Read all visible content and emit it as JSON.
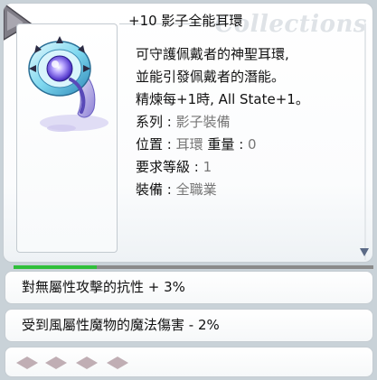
{
  "watermark": "Collections",
  "item": {
    "name": "+10 影子全能耳環",
    "description": [
      "可守護佩戴者的神聖耳環,",
      "並能引發佩戴者的潛能。",
      "精煉每+1時, All State+1。"
    ],
    "attributes": [
      {
        "label": "系列",
        "value": "影子裝備"
      },
      {
        "label": "位置",
        "value": "耳環",
        "extra_label": "重量",
        "extra_value": "0"
      },
      {
        "label": "要求等級",
        "value": "1"
      },
      {
        "label": "裝備",
        "value": "全職業"
      }
    ]
  },
  "options": [
    "對無屬性攻擊的抗性 + 3%",
    "受到風屬性魔物的魔法傷害 - 2%"
  ],
  "progress_fraction": 0.23,
  "card_slots_empty": 4,
  "colors": {
    "background": "#c9d2d8",
    "progress": "#2fbf3a",
    "slot": "#c0aeb4"
  }
}
